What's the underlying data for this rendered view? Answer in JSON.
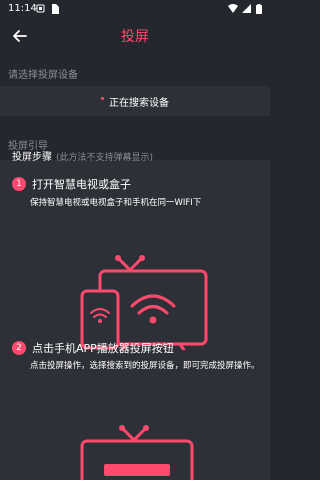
{
  "status_bar": {
    "time": "11:14"
  },
  "header": {
    "title": "投屏"
  },
  "devices": {
    "section_label": "请选择投屏设备",
    "searching_text": "正在搜索设备"
  },
  "guide": {
    "section_label": "投屏引导",
    "title": "投屏步骤",
    "note": "(此方法不支持弹幕显示)",
    "steps": [
      {
        "number": "1",
        "title": "打开智慧电视或盒子",
        "desc": "保持智慧电视或电视盒子和手机在同一WIFI下"
      },
      {
        "number": "2",
        "title": "点击手机APP播放器投屏按钮",
        "desc": "点击投屏操作，选择搜索到的投屏设备，即可完成投屏操作。"
      }
    ]
  },
  "colors": {
    "accent": "#ff4a6e",
    "background": "#25272e",
    "card": "#2e3037",
    "muted": "#8b8e96"
  }
}
